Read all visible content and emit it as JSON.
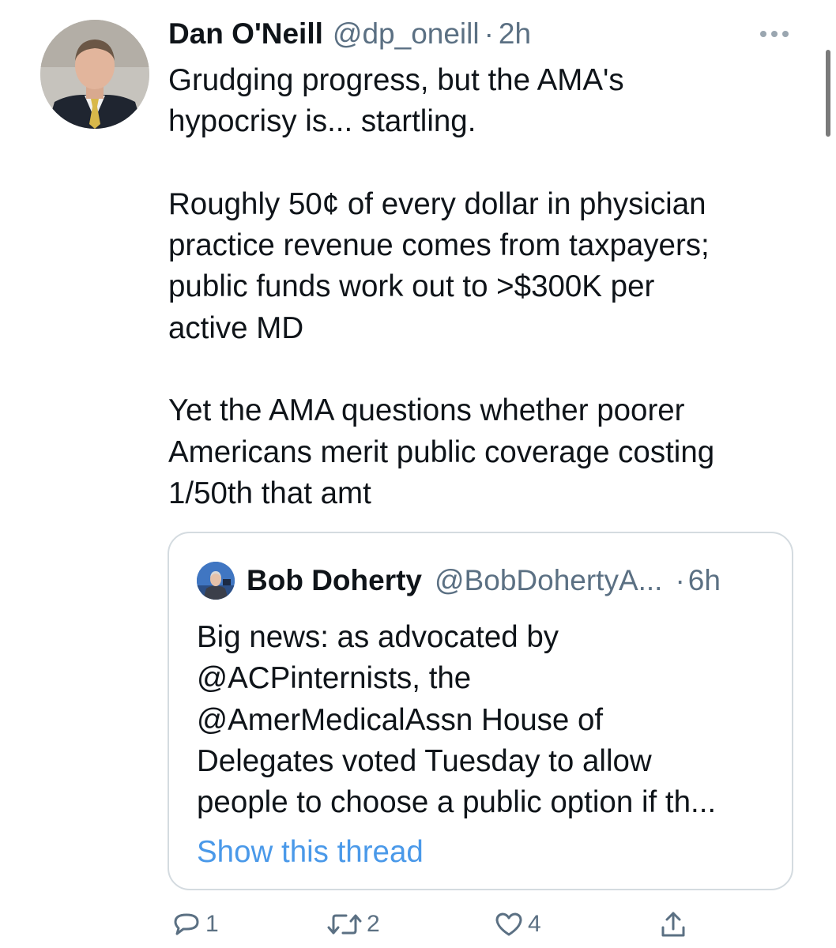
{
  "tweet": {
    "author_name": "Dan O'Neill",
    "author_handle": "@dp_oneill",
    "separator": "·",
    "time": "2h",
    "paragraphs": [
      "Grudging progress, but the AMA's\nhypocrisy is... startling.",
      "Roughly 50¢ of every dollar in physician\npractice revenue comes from taxpayers;\npublic funds work out to >$300K per\nactive MD",
      "Yet the AMA questions whether poorer\nAmericans merit public coverage costing\n1/50th that amt"
    ]
  },
  "quoted_tweet": {
    "author_name": "Bob Doherty",
    "author_handle": "@BobDohertyA...",
    "separator": "·",
    "time": "6h",
    "text": "Big news: as advocated by\n@ACPinternists, the\n@AmerMedicalAssn House of\nDelegates voted Tuesday to allow\npeople to choose a public option if th...",
    "show_thread_label": "Show this thread"
  },
  "actions": {
    "reply_count": "1",
    "retweet_count": "2",
    "like_count": "4"
  },
  "icons": {
    "more": "more-dots-icon",
    "reply": "reply-icon",
    "retweet": "retweet-icon",
    "like": "heart-icon",
    "share": "share-icon"
  },
  "colors": {
    "text": "#0f1419",
    "secondary": "#5b7083",
    "link": "#4a99e9",
    "border": "#d4dbe0"
  }
}
